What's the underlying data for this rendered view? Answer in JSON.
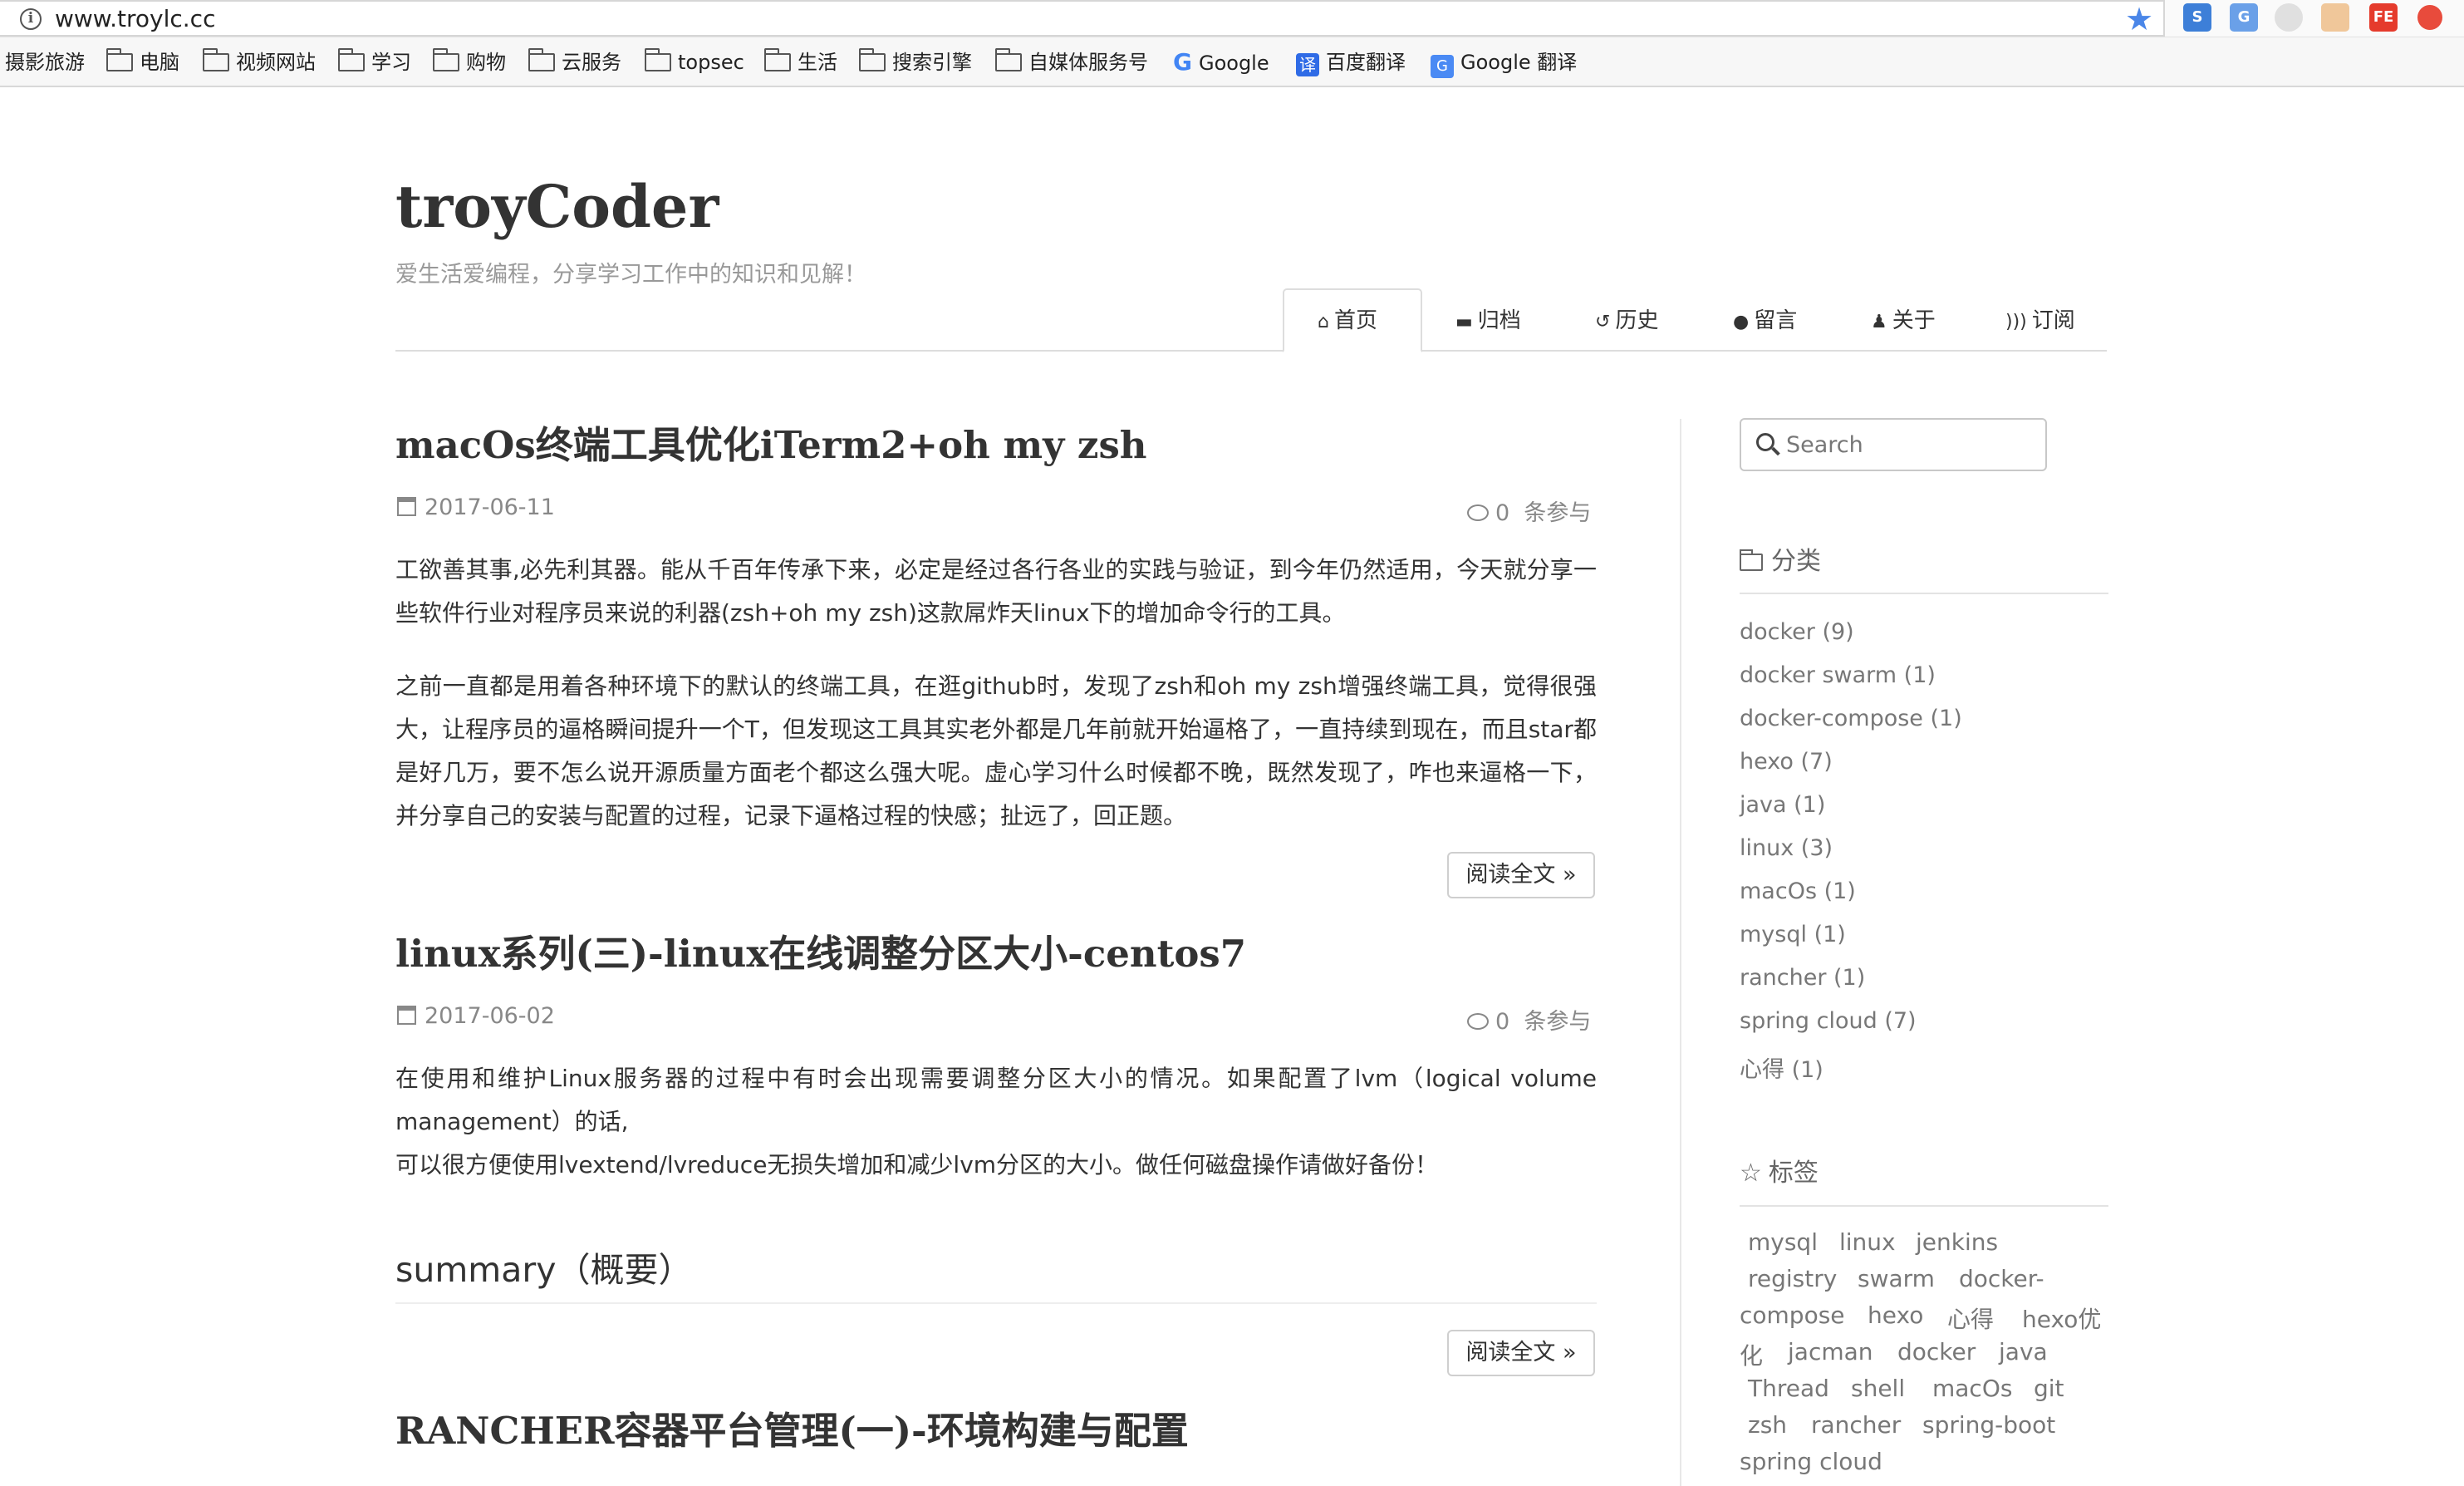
{
  "browser": {
    "url": "www.troylc.cc",
    "bookmarks": [
      {
        "label": "摄影旅游",
        "icon": "none"
      },
      {
        "label": "电脑",
        "icon": "folder-icon"
      },
      {
        "label": "视频网站",
        "icon": "folder-icon"
      },
      {
        "label": "学习",
        "icon": "folder-icon"
      },
      {
        "label": "购物",
        "icon": "folder-icon"
      },
      {
        "label": "云服务",
        "icon": "folder-icon"
      },
      {
        "label": "topsec",
        "icon": "folder-icon"
      },
      {
        "label": "生活",
        "icon": "folder-icon"
      },
      {
        "label": "搜索引擎",
        "icon": "folder-icon"
      },
      {
        "label": "自媒体服务号",
        "icon": "folder-icon"
      },
      {
        "label": "Google",
        "icon": "google-icon"
      },
      {
        "label": "百度翻译",
        "icon": "baidu-translate-icon"
      },
      {
        "label": "Google 翻译",
        "icon": "google-translate-icon"
      }
    ]
  },
  "site": {
    "title": "troyCoder",
    "subtitle": "爱生活爱编程，分享学习工作中的知识和见解！"
  },
  "nav": [
    {
      "label": "首页",
      "icon": "home-icon",
      "active": true
    },
    {
      "label": "归档",
      "icon": "archive-icon"
    },
    {
      "label": "历史",
      "icon": "history-icon"
    },
    {
      "label": "留言",
      "icon": "comments-icon"
    },
    {
      "label": "关于",
      "icon": "user-icon"
    },
    {
      "label": "订阅",
      "icon": "rss-icon"
    }
  ],
  "posts": [
    {
      "title": "macOs终端工具优化iTerm2+oh my zsh",
      "date": "2017-06-11",
      "comments_count": "0",
      "comments_label": "条参与",
      "paragraphs": [
        "工欲善其事,必先利其器。能从千百年传承下来，必定是经过各行各业的实践与验证，到今年仍然适用，今天就分享一些软件行业对程序员来说的利器(zsh+oh my zsh)这款屌炸天linux下的增加命令行的工具。",
        "之前一直都是用着各种环境下的默认的终端工具，在逛github时，发现了zsh和oh my zsh增强终端工具，觉得很强大，让程序员的逼格瞬间提升一个T，但发现这工具其实老外都是几年前就开始逼格了，一直持续到现在，而且star都是好几万，要不怎么说开源质量方面老个都这么强大呢。虚心学习什么时候都不晚，既然发现了，咋也来逼格一下，并分享自己的安装与配置的过程，记录下逼格过程的快感；扯远了，回正题。"
      ],
      "read_more": "阅读全文 »"
    },
    {
      "title": "linux系列(三)-linux在线调整分区大小-centos7",
      "date": "2017-06-02",
      "comments_count": "0",
      "comments_label": "条参与",
      "paragraphs": [
        "在使用和维护Linux服务器的过程中有时会出现需要调整分区大小的情况。如果配置了lvm（logical volume management）的话,",
        "可以很方便使用lvextend/lvreduce无损失增加和减少lvm分区的大小。做任何磁盘操作请做好备份！"
      ],
      "summary_heading": "summary（概要）",
      "read_more": "阅读全文 »"
    },
    {
      "title": "RANCHER容器平台管理(一)-环境构建与配置"
    }
  ],
  "sidebar": {
    "search_placeholder": "Search",
    "categories_heading": "分类",
    "categories": [
      "docker (9)",
      "docker swarm (1)",
      "docker-compose (1)",
      "hexo (7)",
      "java (1)",
      "linux (3)",
      "macOs (1)",
      "mysql (1)",
      "rancher (1)",
      "spring cloud (7)",
      "心得 (1)"
    ],
    "tags_heading": "标签",
    "tags": [
      "mysql",
      "linux",
      "jenkins",
      "registry",
      "swarm",
      "docker-",
      "compose",
      "hexo",
      "心得",
      "hexo优",
      "化",
      "jacman",
      "docker",
      "java",
      "Thread",
      "shell",
      "macOs",
      "git",
      "zsh",
      "rancher",
      "spring-boot",
      "spring cloud"
    ]
  }
}
